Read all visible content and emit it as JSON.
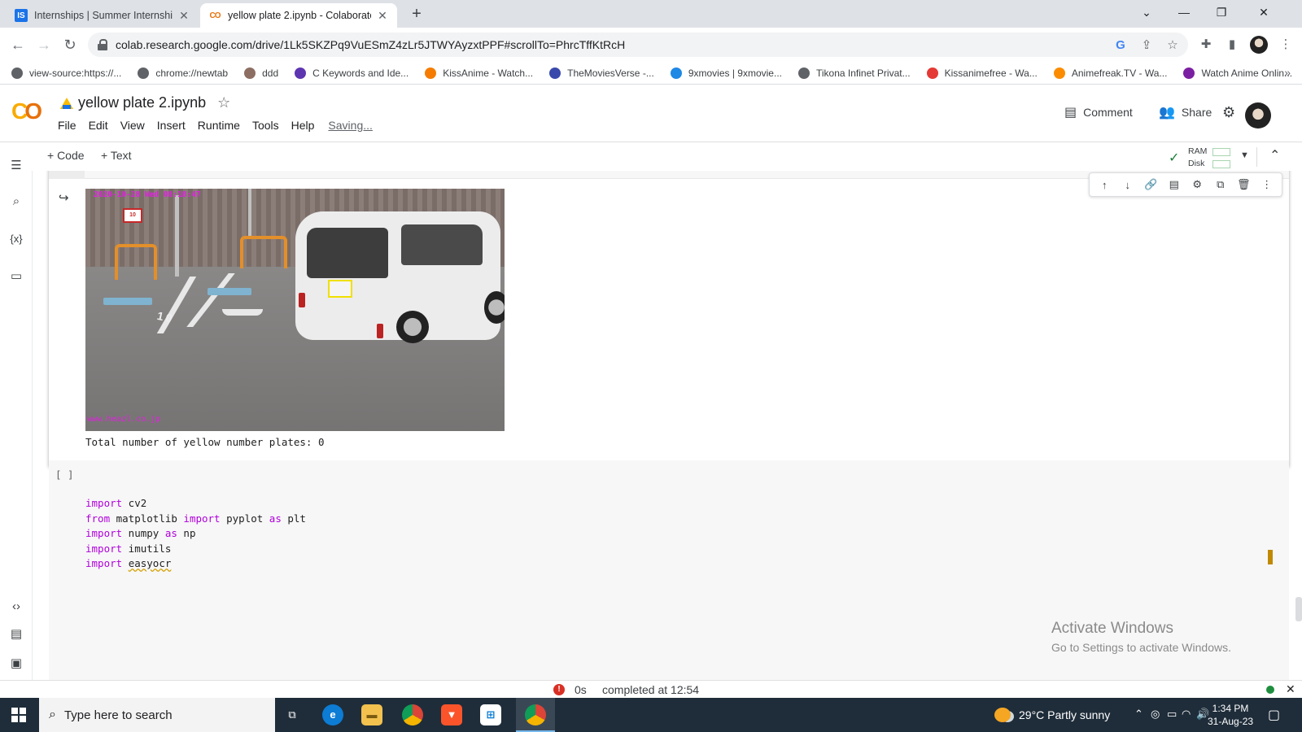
{
  "browser": {
    "tabs": [
      {
        "title": "Internships | Summer Internship 2",
        "favicon": "IS"
      },
      {
        "title": "yellow plate 2.ipynb - Colaborato",
        "favicon": "CO",
        "active": true
      }
    ],
    "url": "colab.research.google.com/drive/1Lk5SKZPq9VuESmZ4zLr5JTWYAyzxtPPF#scrollTo=PhrcTffKtRcH",
    "bookmarks": [
      {
        "label": "view-source:https://...",
        "icon": "globe-icon",
        "color": "#5f6368"
      },
      {
        "label": "chrome://newtab",
        "icon": "globe-icon",
        "color": "#5f6368"
      },
      {
        "label": "ddd",
        "icon": "avatar-icon",
        "color": "#8d6e63"
      },
      {
        "label": "C Keywords and Ide...",
        "icon": "p-icon",
        "color": "#5e35b1"
      },
      {
        "label": "KissAnime - Watch...",
        "icon": "kiss-icon",
        "color": "#f57c00"
      },
      {
        "label": "TheMoviesVerse -...",
        "icon": "m-icon",
        "color": "#3949ab"
      },
      {
        "label": "9xmovies | 9xmovie...",
        "icon": "play-icon",
        "color": "#1e88e5"
      },
      {
        "label": "Tikona Infinet Privat...",
        "icon": "globe-icon",
        "color": "#5f6368"
      },
      {
        "label": "Kissanimefree - Wa...",
        "icon": "kiss-red-icon",
        "color": "#e53935"
      },
      {
        "label": "Animefreak.TV - Wa...",
        "icon": "anime-icon",
        "color": "#fb8c00"
      },
      {
        "label": "Watch Anime Onlin...",
        "icon": "play-purple-icon",
        "color": "#7b1fa2"
      }
    ]
  },
  "colab": {
    "logo": "CO",
    "notebook_title": "yellow plate 2.ipynb",
    "menu": [
      "File",
      "Edit",
      "View",
      "Insert",
      "Runtime",
      "Tools",
      "Help"
    ],
    "save_status": "Saving...",
    "comment_label": "Comment",
    "share_label": "Share",
    "add_code_label": "+ Code",
    "add_text_label": "+ Text",
    "ram_label": "RAM",
    "disk_label": "Disk"
  },
  "output_cell": {
    "image_timestamp": "2020-10-28 Wed 08:18:47",
    "image_watermark": "www.heazl.co.jp",
    "sign_text": "10",
    "floor_number": "10",
    "stdout": "Total number of yellow number plates: 0"
  },
  "code_cell": {
    "run_indicator": "[ ]",
    "lines": [
      [
        {
          "t": "import",
          "kw": true
        },
        {
          "t": " cv2"
        }
      ],
      [
        {
          "t": "from",
          "kw": true
        },
        {
          "t": " matplotlib "
        },
        {
          "t": "import",
          "kw": true
        },
        {
          "t": " pyplot "
        },
        {
          "t": "as",
          "kw": true
        },
        {
          "t": " plt"
        }
      ],
      [
        {
          "t": "import",
          "kw": true
        },
        {
          "t": " numpy "
        },
        {
          "t": "as",
          "kw": true
        },
        {
          "t": " np"
        }
      ],
      [
        {
          "t": "import",
          "kw": true
        },
        {
          "t": " imutils"
        }
      ],
      [
        {
          "t": "import",
          "kw": true
        },
        {
          "t": " "
        },
        {
          "t": "easyocr",
          "squiggle": true
        }
      ]
    ]
  },
  "watermark": {
    "line1": "Activate Windows",
    "line2": "Go to Settings to activate Windows."
  },
  "statusbar": {
    "duration": "0s",
    "text": "completed at 12:54"
  },
  "taskbar": {
    "search_placeholder": "Type here to search",
    "weather": "29°C  Partly sunny",
    "time": "1:34 PM",
    "date": "31-Aug-23"
  }
}
